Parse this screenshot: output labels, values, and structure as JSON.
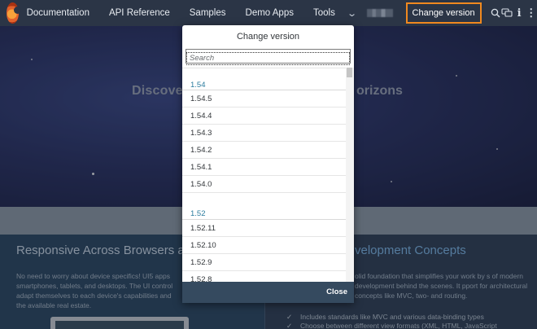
{
  "topbar": {
    "nav": [
      "Documentation",
      "API Reference",
      "Samples",
      "Demo Apps",
      "Tools"
    ],
    "change_version_label": "Change version",
    "icons": [
      "logo-icon",
      "chevron-down-icon",
      "search-icon",
      "feedback-icon",
      "info-icon",
      "ellipsis-icon"
    ]
  },
  "hero": {
    "title_left": "Discove",
    "title_right": "orizons"
  },
  "sections": {
    "left": {
      "title": "Responsive Across Browsers and",
      "text": "No need to worry about device specifics! UI5 apps smartphones, tablets, and desktops. The UI control adapt themselves to each device's capabilities and the available real estate."
    },
    "right": {
      "title": "velopment Concepts",
      "text": "olid foundation that simplifies your work by s of modern development behind the scenes. It pport for architectural concepts like MVC, two- and routing.",
      "bullets": [
        "Includes standards like MVC and various data-binding types",
        "Choose between different view formats (XML, HTML, JavaScript"
      ]
    }
  },
  "dialog": {
    "title": "Change version",
    "search_placeholder": "Search",
    "groups": [
      {
        "label": "1.54",
        "items": [
          "1.54.5",
          "1.54.4",
          "1.54.3",
          "1.54.2",
          "1.54.1",
          "1.54.0"
        ]
      },
      {
        "label": "1.52",
        "items": [
          "1.52.11",
          "1.52.10",
          "1.52.9",
          "1.52.8"
        ]
      }
    ],
    "close_label": "Close"
  },
  "colors": {
    "topbar": "#2b3546",
    "highlight": "#f0891f",
    "group_label": "#2b7c9e",
    "dialog_footer": "#354a5f"
  }
}
